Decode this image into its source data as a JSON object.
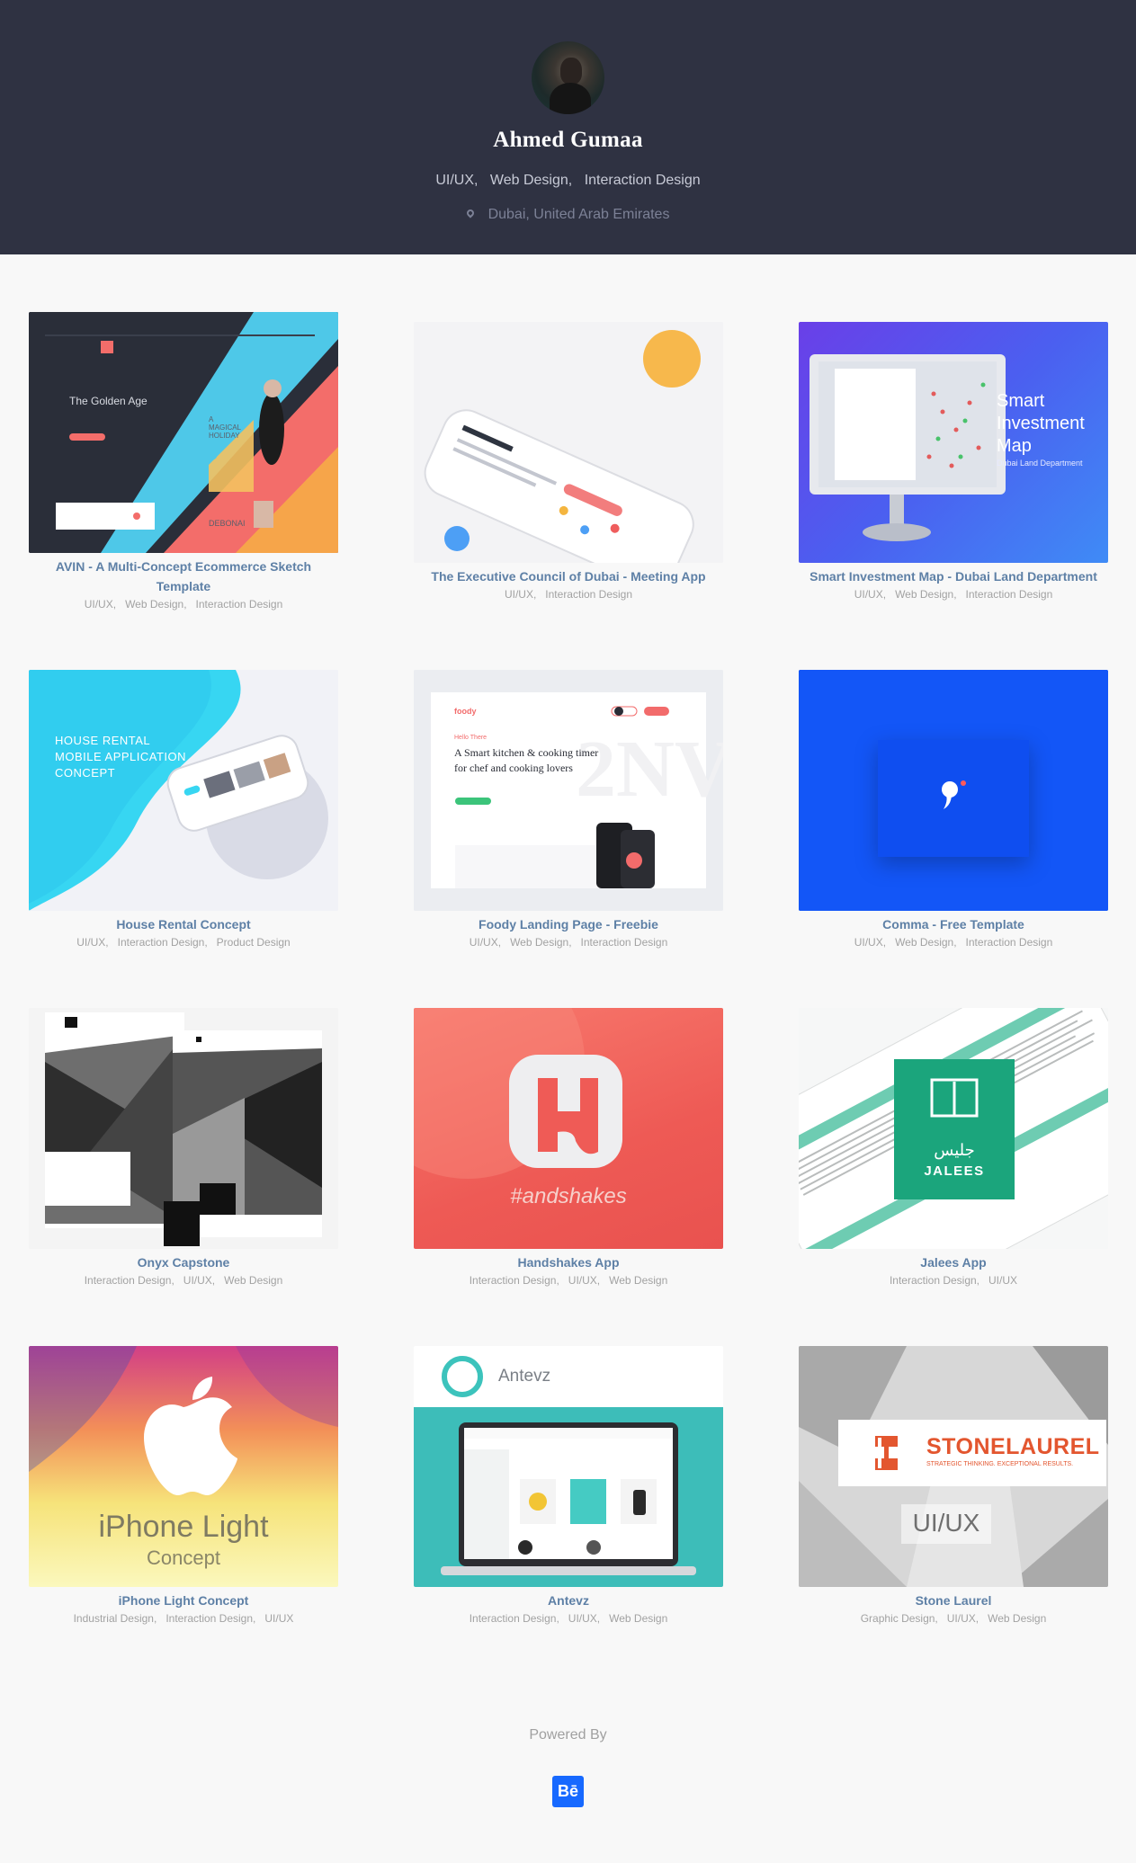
{
  "profile": {
    "name": "Ahmed Gumaa",
    "fields": [
      "UI/UX,",
      "Web Design,",
      "Interaction Design"
    ],
    "location": "Dubai, United Arab Emirates"
  },
  "projects": [
    {
      "title": "AVIN - A Multi-Concept Ecommerce Sketch Template",
      "tags": [
        "UI/UX,",
        "Web Design,",
        "Interaction Design"
      ]
    },
    {
      "title": "The Executive Council of Dubai - Meeting App",
      "tags": [
        "UI/UX,",
        "Interaction Design"
      ]
    },
    {
      "title": "Smart Investment Map - Dubai Land Department",
      "tags": [
        "UI/UX,",
        "Web Design,",
        "Interaction Design"
      ]
    },
    {
      "title": "House Rental Concept",
      "tags": [
        "UI/UX,",
        "Interaction Design,",
        "Product Design"
      ]
    },
    {
      "title": "Foody Landing Page - Freebie",
      "tags": [
        "UI/UX,",
        "Web Design,",
        "Interaction Design"
      ]
    },
    {
      "title": "Comma - Free Template",
      "tags": [
        "UI/UX,",
        "Web Design,",
        "Interaction Design"
      ]
    },
    {
      "title": "Onyx Capstone",
      "tags": [
        "Interaction Design,",
        "UI/UX,",
        "Web Design"
      ]
    },
    {
      "title": "Handshakes App",
      "tags": [
        "Interaction Design,",
        "UI/UX,",
        "Web Design"
      ]
    },
    {
      "title": "Jalees App",
      "tags": [
        "Interaction Design,",
        "UI/UX"
      ]
    },
    {
      "title": "iPhone Light Concept",
      "tags": [
        "Industrial Design,",
        "Interaction Design,",
        "UI/UX"
      ]
    },
    {
      "title": "Antevz",
      "tags": [
        "Interaction Design,",
        "UI/UX,",
        "Web Design"
      ]
    },
    {
      "title": "Stone Laurel",
      "tags": [
        "Graphic Design,",
        "UI/UX,",
        "Web Design"
      ]
    }
  ],
  "thumbs": {
    "avin": {
      "headline": "The Golden Age",
      "side": "A MAGICAL HOLIDAY",
      "corner": "DEBONAI"
    },
    "smart_map": {
      "line1": "Smart",
      "line2": "Investment",
      "line3": "Map",
      "sub": "Dubai Land Department"
    },
    "house": {
      "line1": "HOUSE RENTAL",
      "line2": "MOBILE APPLICATION",
      "line3": "CONCEPT"
    },
    "foody": {
      "logo": "foody",
      "hello": "Hello There",
      "headline": "A Smart kitchen & cooking timer for chef and cooking lovers"
    },
    "handshakes": {
      "wordmark": "#andshakes"
    },
    "jalees": {
      "arabic": "جليس",
      "latin": "JALEES"
    },
    "iphone": {
      "line1": "iPhone Light",
      "line2": "Concept"
    },
    "antevz": {
      "brand": "Antevz"
    },
    "stone": {
      "brand": "STONELAUREL",
      "tagline": "STRATEGIC THINKING. EXCEPTIONAL RESULTS.",
      "sub": "UI/UX"
    }
  },
  "footer": {
    "powered_by": "Powered By",
    "logo": "Bē"
  },
  "colors": {
    "header_bg": "#2f3242",
    "title_blue": "#5e80a6",
    "behance_blue": "#1769ff"
  }
}
